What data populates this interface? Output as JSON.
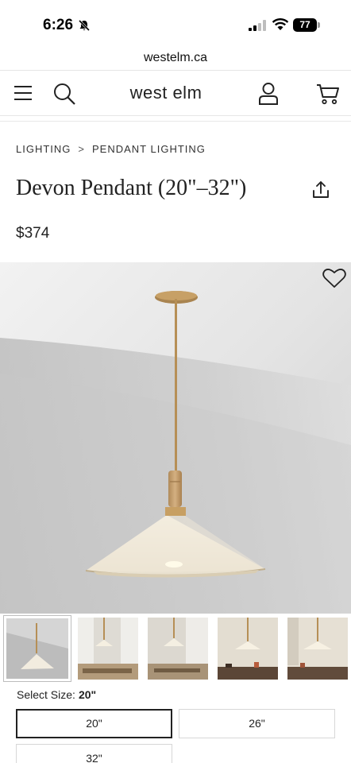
{
  "status_bar": {
    "time": "6:26",
    "battery": "77"
  },
  "browser": {
    "url": "westelm.ca"
  },
  "header": {
    "logo": "west elm"
  },
  "breadcrumb": {
    "items": [
      "LIGHTING",
      "PENDANT LIGHTING"
    ],
    "separator": ">"
  },
  "product": {
    "title": "Devon Pendant (20\"–32\")",
    "price": "$374"
  },
  "size_selector": {
    "label": "Select Size:",
    "selected": "20\"",
    "options": [
      "20\"",
      "26\"",
      "32\""
    ]
  },
  "icons": [
    "menu-icon",
    "search-icon",
    "account-icon",
    "cart-icon",
    "share-icon",
    "heart-icon",
    "bell-off-icon",
    "signal-icon",
    "wifi-icon"
  ],
  "colors": {
    "selected_border": "#222222",
    "option_border": "#d7d7d7",
    "brass": "#b68f56",
    "shade": "#f3ede0"
  }
}
